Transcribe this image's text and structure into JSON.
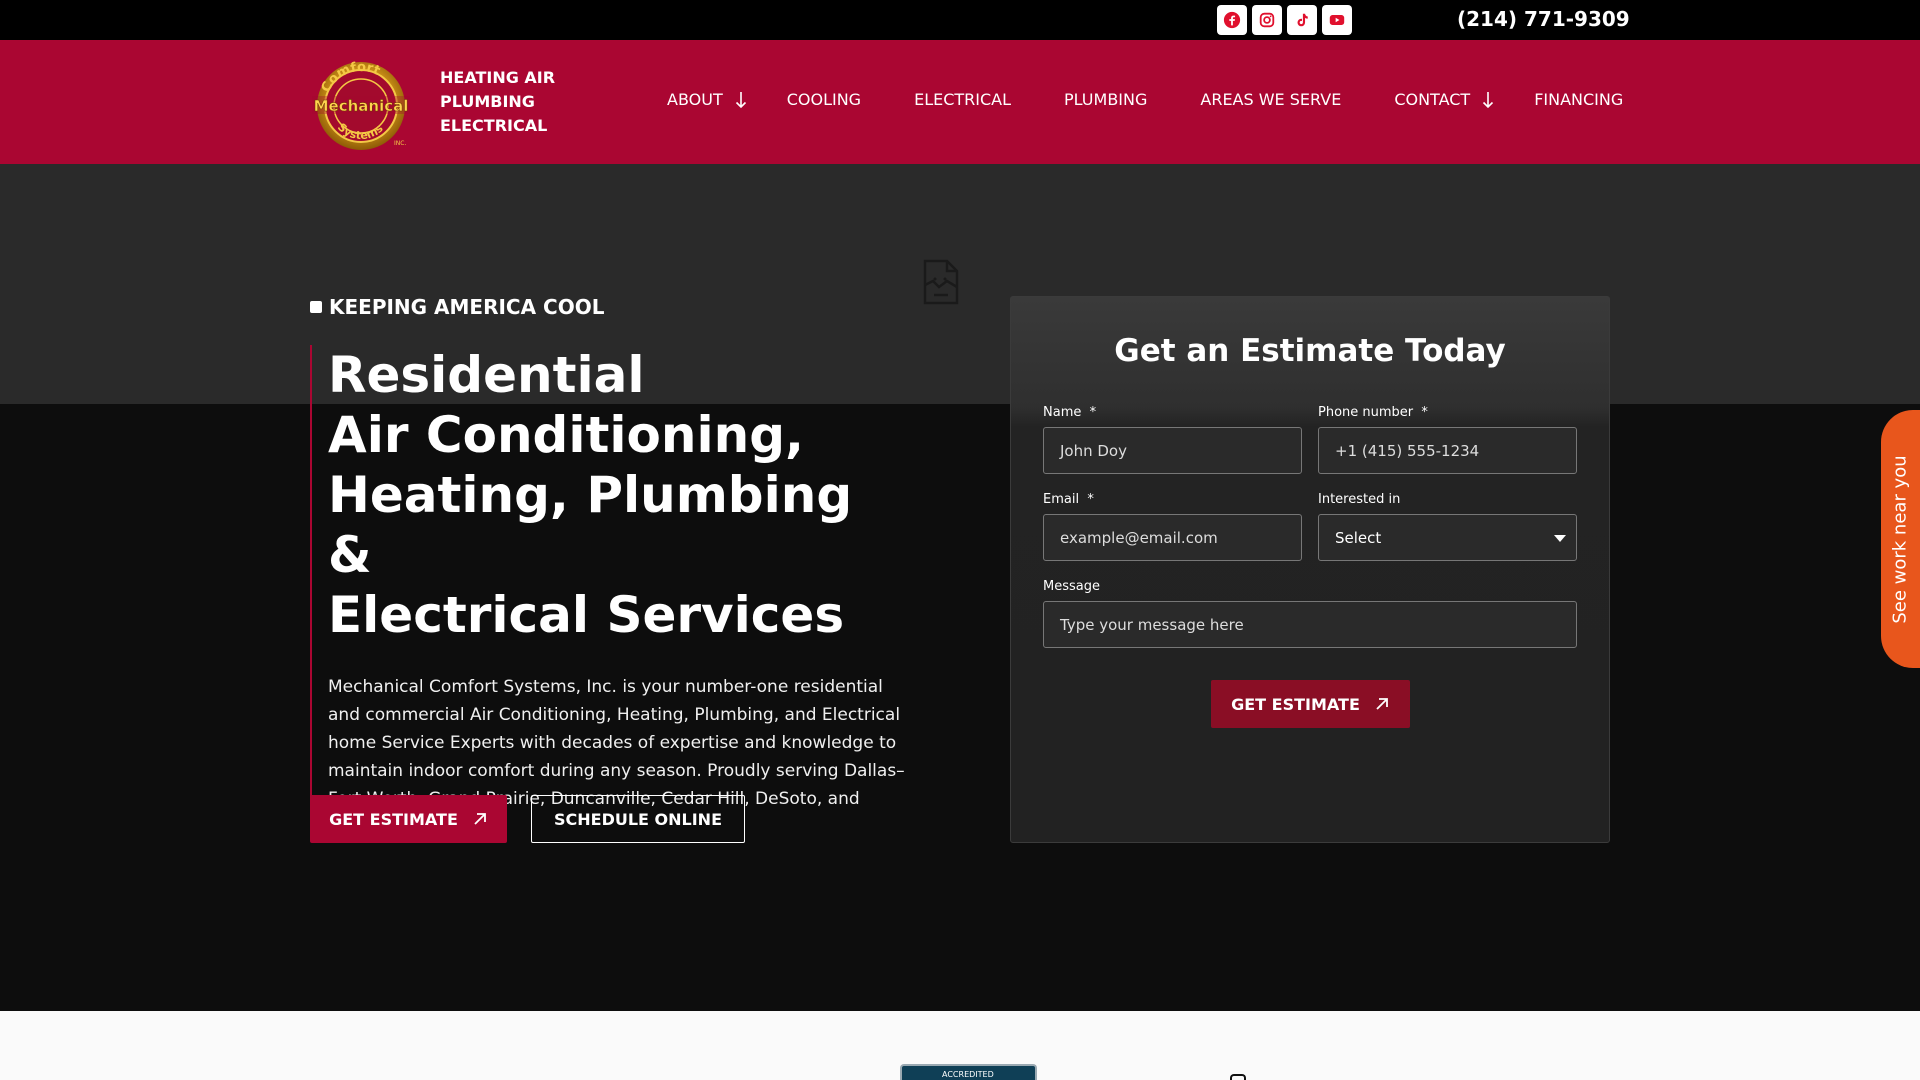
{
  "topbar": {
    "socials": [
      {
        "icon": "facebook-icon",
        "color": "#e0102d"
      },
      {
        "icon": "instagram-icon",
        "color": "#e0102d"
      },
      {
        "icon": "tiktok-icon",
        "color": "#e0102d"
      },
      {
        "icon": "youtube-icon",
        "color": "#e0102d"
      }
    ],
    "phone": "(214) 771-9309"
  },
  "header": {
    "brand_color": "#aa0632",
    "logo_words": [
      "Comfort",
      "Mechanical",
      "Systems",
      "INC."
    ],
    "tagline": [
      "HEATING AIR",
      "PLUMBING",
      "ELECTRICAL"
    ],
    "nav": [
      {
        "label": "ABOUT",
        "has_dropdown": true
      },
      {
        "label": "COOLING",
        "has_dropdown": false
      },
      {
        "label": "ELECTRICAL",
        "has_dropdown": false
      },
      {
        "label": "PLUMBING",
        "has_dropdown": false
      },
      {
        "label": "AREAS WE SERVE",
        "has_dropdown": false
      },
      {
        "label": "CONTACT",
        "has_dropdown": true
      },
      {
        "label": "FINANCING",
        "has_dropdown": false
      }
    ]
  },
  "hero": {
    "eyebrow": "KEEPING AMERICA COOL",
    "title_lines": [
      "Residential",
      "Air Conditioning,",
      "Heating, Plumbing &",
      "Electrical Services"
    ],
    "description": "Mechanical Comfort Systems, Inc. is your number-one residential and commercial Air Conditioning, Heating, Plumbing, and Electrical home Service Experts with decades of expertise and knowledge to maintain indoor comfort during any season. Proudly serving Dallas–Fort Worth, Grand Prairie, Duncanville, Cedar Hill, DeSoto, and surrounding areas,",
    "primary_button": "GET ESTIMATE",
    "secondary_button": "SCHEDULE ONLINE"
  },
  "form": {
    "title": "Get an Estimate Today",
    "name_label": "Name",
    "name_placeholder": "John Doy",
    "phone_label": "Phone number",
    "phone_placeholder": "+1 (415) 555-1234",
    "email_label": "Email",
    "email_placeholder": "example@email.com",
    "interest_label": "Interested in",
    "interest_value": "Select",
    "message_label": "Message",
    "message_placeholder": "Type your message here",
    "required_mark": "*",
    "submit": "GET ESTIMATE"
  },
  "side_tab": {
    "label": "See work near you",
    "color": "#e8561c"
  },
  "footer_strip": {
    "badge_text": "ACCREDITED"
  }
}
